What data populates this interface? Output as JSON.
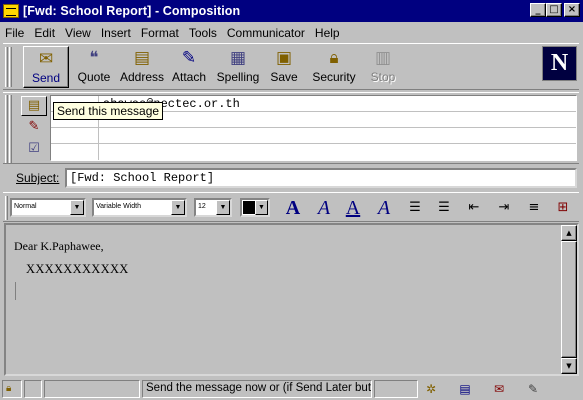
{
  "window": {
    "title": "[Fwd: School Report] - Composition",
    "minimize": "_",
    "maximize": "□",
    "close": "×"
  },
  "menu": [
    "File",
    "Edit",
    "View",
    "Insert",
    "Format",
    "Tools",
    "Communicator",
    "Help"
  ],
  "toolbar": {
    "buttons": [
      {
        "label": "Send",
        "icon": "send-icon"
      },
      {
        "label": "Quote",
        "icon": "quote-icon"
      },
      {
        "label": "Address",
        "icon": "address-book-icon"
      },
      {
        "label": "Attach",
        "icon": "paperclip-icon"
      },
      {
        "label": "Spelling",
        "icon": "spelling-icon"
      },
      {
        "label": "Save",
        "icon": "save-icon"
      },
      {
        "label": "Security",
        "icon": "lock-icon"
      },
      {
        "label": "Stop",
        "icon": "stop-icon",
        "disabled": true
      }
    ],
    "logo": "N"
  },
  "address": {
    "recipient": "ahawee@nectec.or.th",
    "tooltip": "Send this message"
  },
  "subject": {
    "label": "Subject:",
    "value": "[Fwd: School Report]"
  },
  "format": {
    "paragraph_style": "Normal",
    "font": "Variable Width",
    "size": "12",
    "text_color": "#000000"
  },
  "body": {
    "greeting": "Dear K.Paphawee,",
    "line": "XXXXXXXXXXX"
  },
  "status": {
    "message": "Send the message now  or (if Send Later button is visil"
  }
}
